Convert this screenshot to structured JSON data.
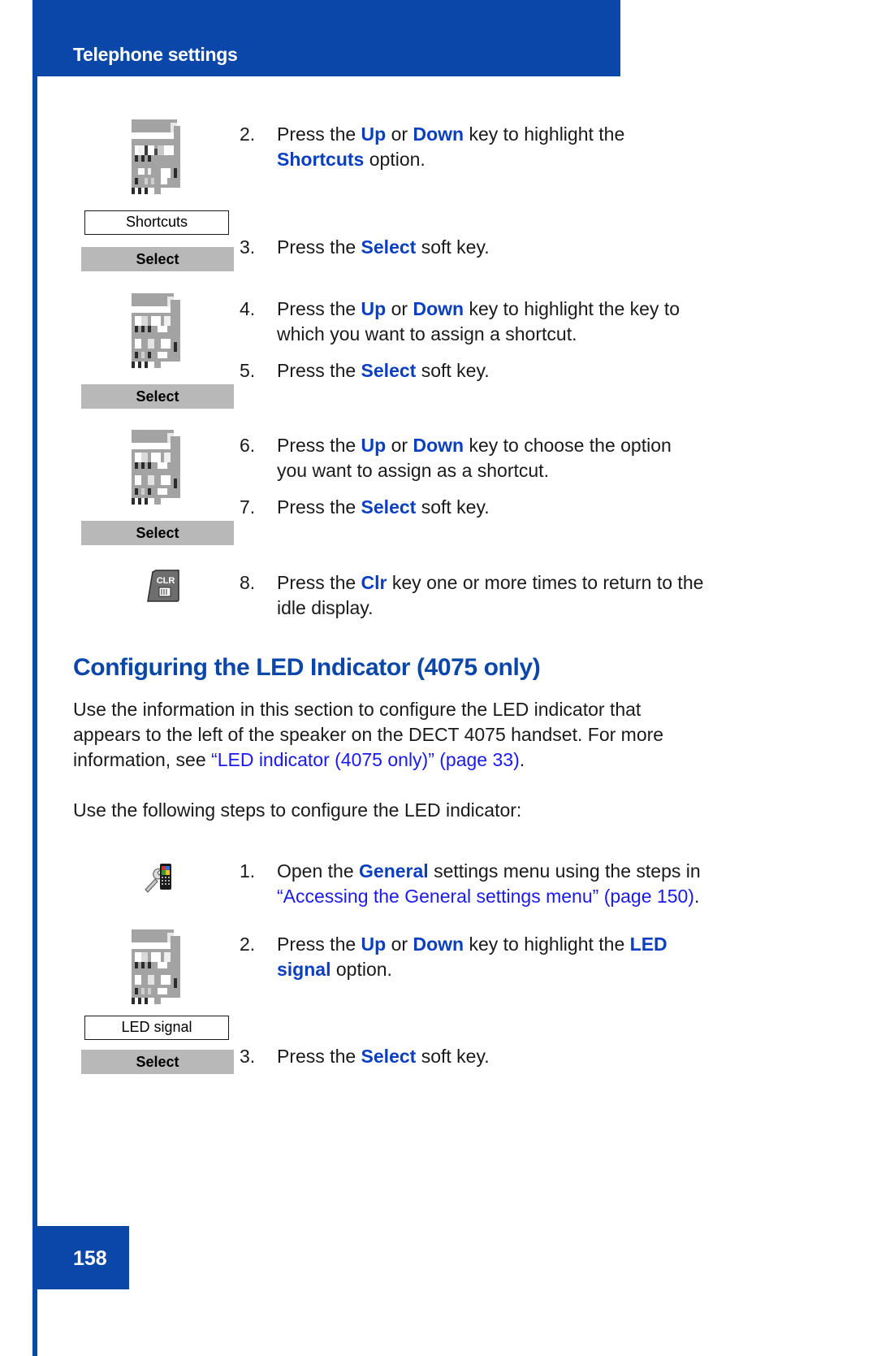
{
  "header": {
    "title": "Telephone settings"
  },
  "page": {
    "number": "158"
  },
  "shortcuts_section": {
    "steps": [
      {
        "num": "2.",
        "parts": [
          {
            "t": "Press the ",
            "s": "plain"
          },
          {
            "t": "Up",
            "s": "blue"
          },
          {
            "t": " or ",
            "s": "plain"
          },
          {
            "t": "Down",
            "s": "blue"
          },
          {
            "t": " key to highlight the ",
            "s": "plain"
          },
          {
            "t": "Shortcuts",
            "s": "blue"
          },
          {
            "t": " option.",
            "s": "plain"
          }
        ],
        "line1": "Press the Up or Down key to highlight the",
        "line2": "Shortcuts option."
      },
      {
        "num": "3.",
        "line1": "Press the Select soft key."
      },
      {
        "num": "4.",
        "line1": "Press the Up or Down key to highlight the key to",
        "line2": "which you want to assign a shortcut."
      },
      {
        "num": "5.",
        "line1": "Press the Select soft key."
      },
      {
        "num": "6.",
        "line1": "Press the Up or Down key to choose the option",
        "line2": "you want to assign as a shortcut."
      },
      {
        "num": "7.",
        "line1": "Press the Select soft key."
      },
      {
        "num": "8.",
        "line1": "Press the Clr key one or more times to return to the",
        "line2": "idle display."
      }
    ],
    "option_label": "Shortcuts",
    "softkey_label": "Select",
    "clr_key_label": "CLR"
  },
  "led_section": {
    "heading": "Configuring the LED Indicator (4075 only)",
    "intro_line1": "Use the information in this section to configure the LED indicator that",
    "intro_line2": "appears to the left of the speaker on the DECT 4075 handset. For more",
    "intro_line3_pre": "information, see ",
    "intro_line3_link": "“LED indicator (4075 only)” (page 33)",
    "intro_line3_post": ".",
    "steps_intro": "Use the following steps to configure the LED indicator:",
    "steps": [
      {
        "num": "1.",
        "line1_pre": "Open the ",
        "line1_bold": "General",
        "line1_post": " settings menu using the steps in",
        "line2_link": "“Accessing the General settings menu” (page 150)",
        "line2_post": "."
      },
      {
        "num": "2.",
        "line1_pre": "Press the ",
        "line1_b1": "Up",
        "line1_mid": " or ",
        "line1_b2": "Down",
        "line1_post": " key to highlight the ",
        "line1_b3": "LED",
        "line2_b": "signal",
        "line2_post": " option."
      },
      {
        "num": "3.",
        "line1": "Press the Select soft key."
      }
    ],
    "option_label": "LED signal",
    "softkey_label": "Select"
  },
  "labels": {
    "press_the": "Press the ",
    "or": " or ",
    "up": "Up",
    "down": "Down",
    "select": "Select",
    "soft_key_suffix": " soft key.",
    "key_to_highlight_the": " key to highlight the",
    "option_word": " option.",
    "clr": "Clr"
  },
  "colors": {
    "brand_blue": "#0a47a8",
    "accent_blue": "#0a3fc0",
    "link_blue": "#1a1aee",
    "softkey_gray": "#b8b8b8"
  }
}
